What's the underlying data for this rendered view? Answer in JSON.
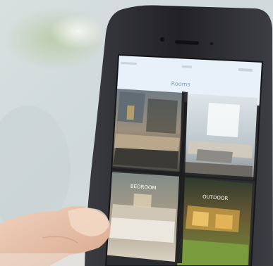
{
  "phone": {
    "status_bar": {
      "carrier": "",
      "time": "",
      "battery": ""
    },
    "nav_title": "Rooms"
  },
  "tiles": [
    {
      "label": "",
      "scene": "kitchen"
    },
    {
      "label": "",
      "scene": "living-room"
    },
    {
      "label": "BEDROOM",
      "scene": "bedroom"
    },
    {
      "label": "OUTDOOR",
      "scene": "outdoor"
    }
  ],
  "colors": {
    "phone_frame": "#2a2a2e",
    "screen_header": "#e8f1fa",
    "screen_title": "#7fa2c4",
    "skin": "#e9c6b0"
  }
}
